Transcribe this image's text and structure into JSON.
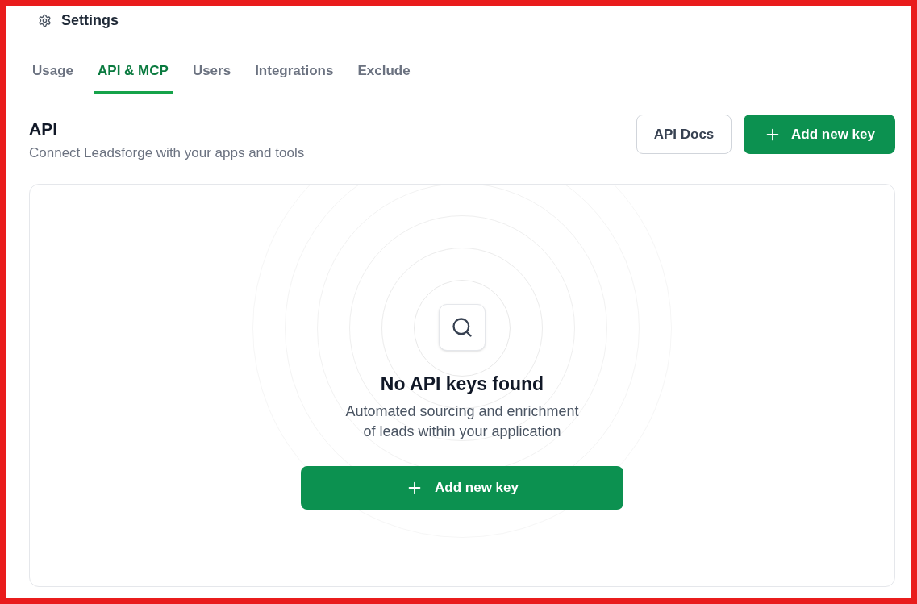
{
  "header": {
    "title": "Settings"
  },
  "tabs": [
    {
      "label": "Usage",
      "selected": false
    },
    {
      "label": "API & MCP",
      "selected": true
    },
    {
      "label": "Users",
      "selected": false
    },
    {
      "label": "Integrations",
      "selected": false
    },
    {
      "label": "Exclude",
      "selected": false
    }
  ],
  "section": {
    "title": "API",
    "subtitle": "Connect Leadsforge with your apps and tools",
    "actions": [
      {
        "label": "API Docs",
        "kind": "outline"
      },
      {
        "label": "Add new key",
        "kind": "primary"
      }
    ]
  },
  "empty_state": {
    "title": "No API keys found",
    "description": "Automated sourcing and enrichment of leads within your application",
    "button": "Add new key"
  }
}
